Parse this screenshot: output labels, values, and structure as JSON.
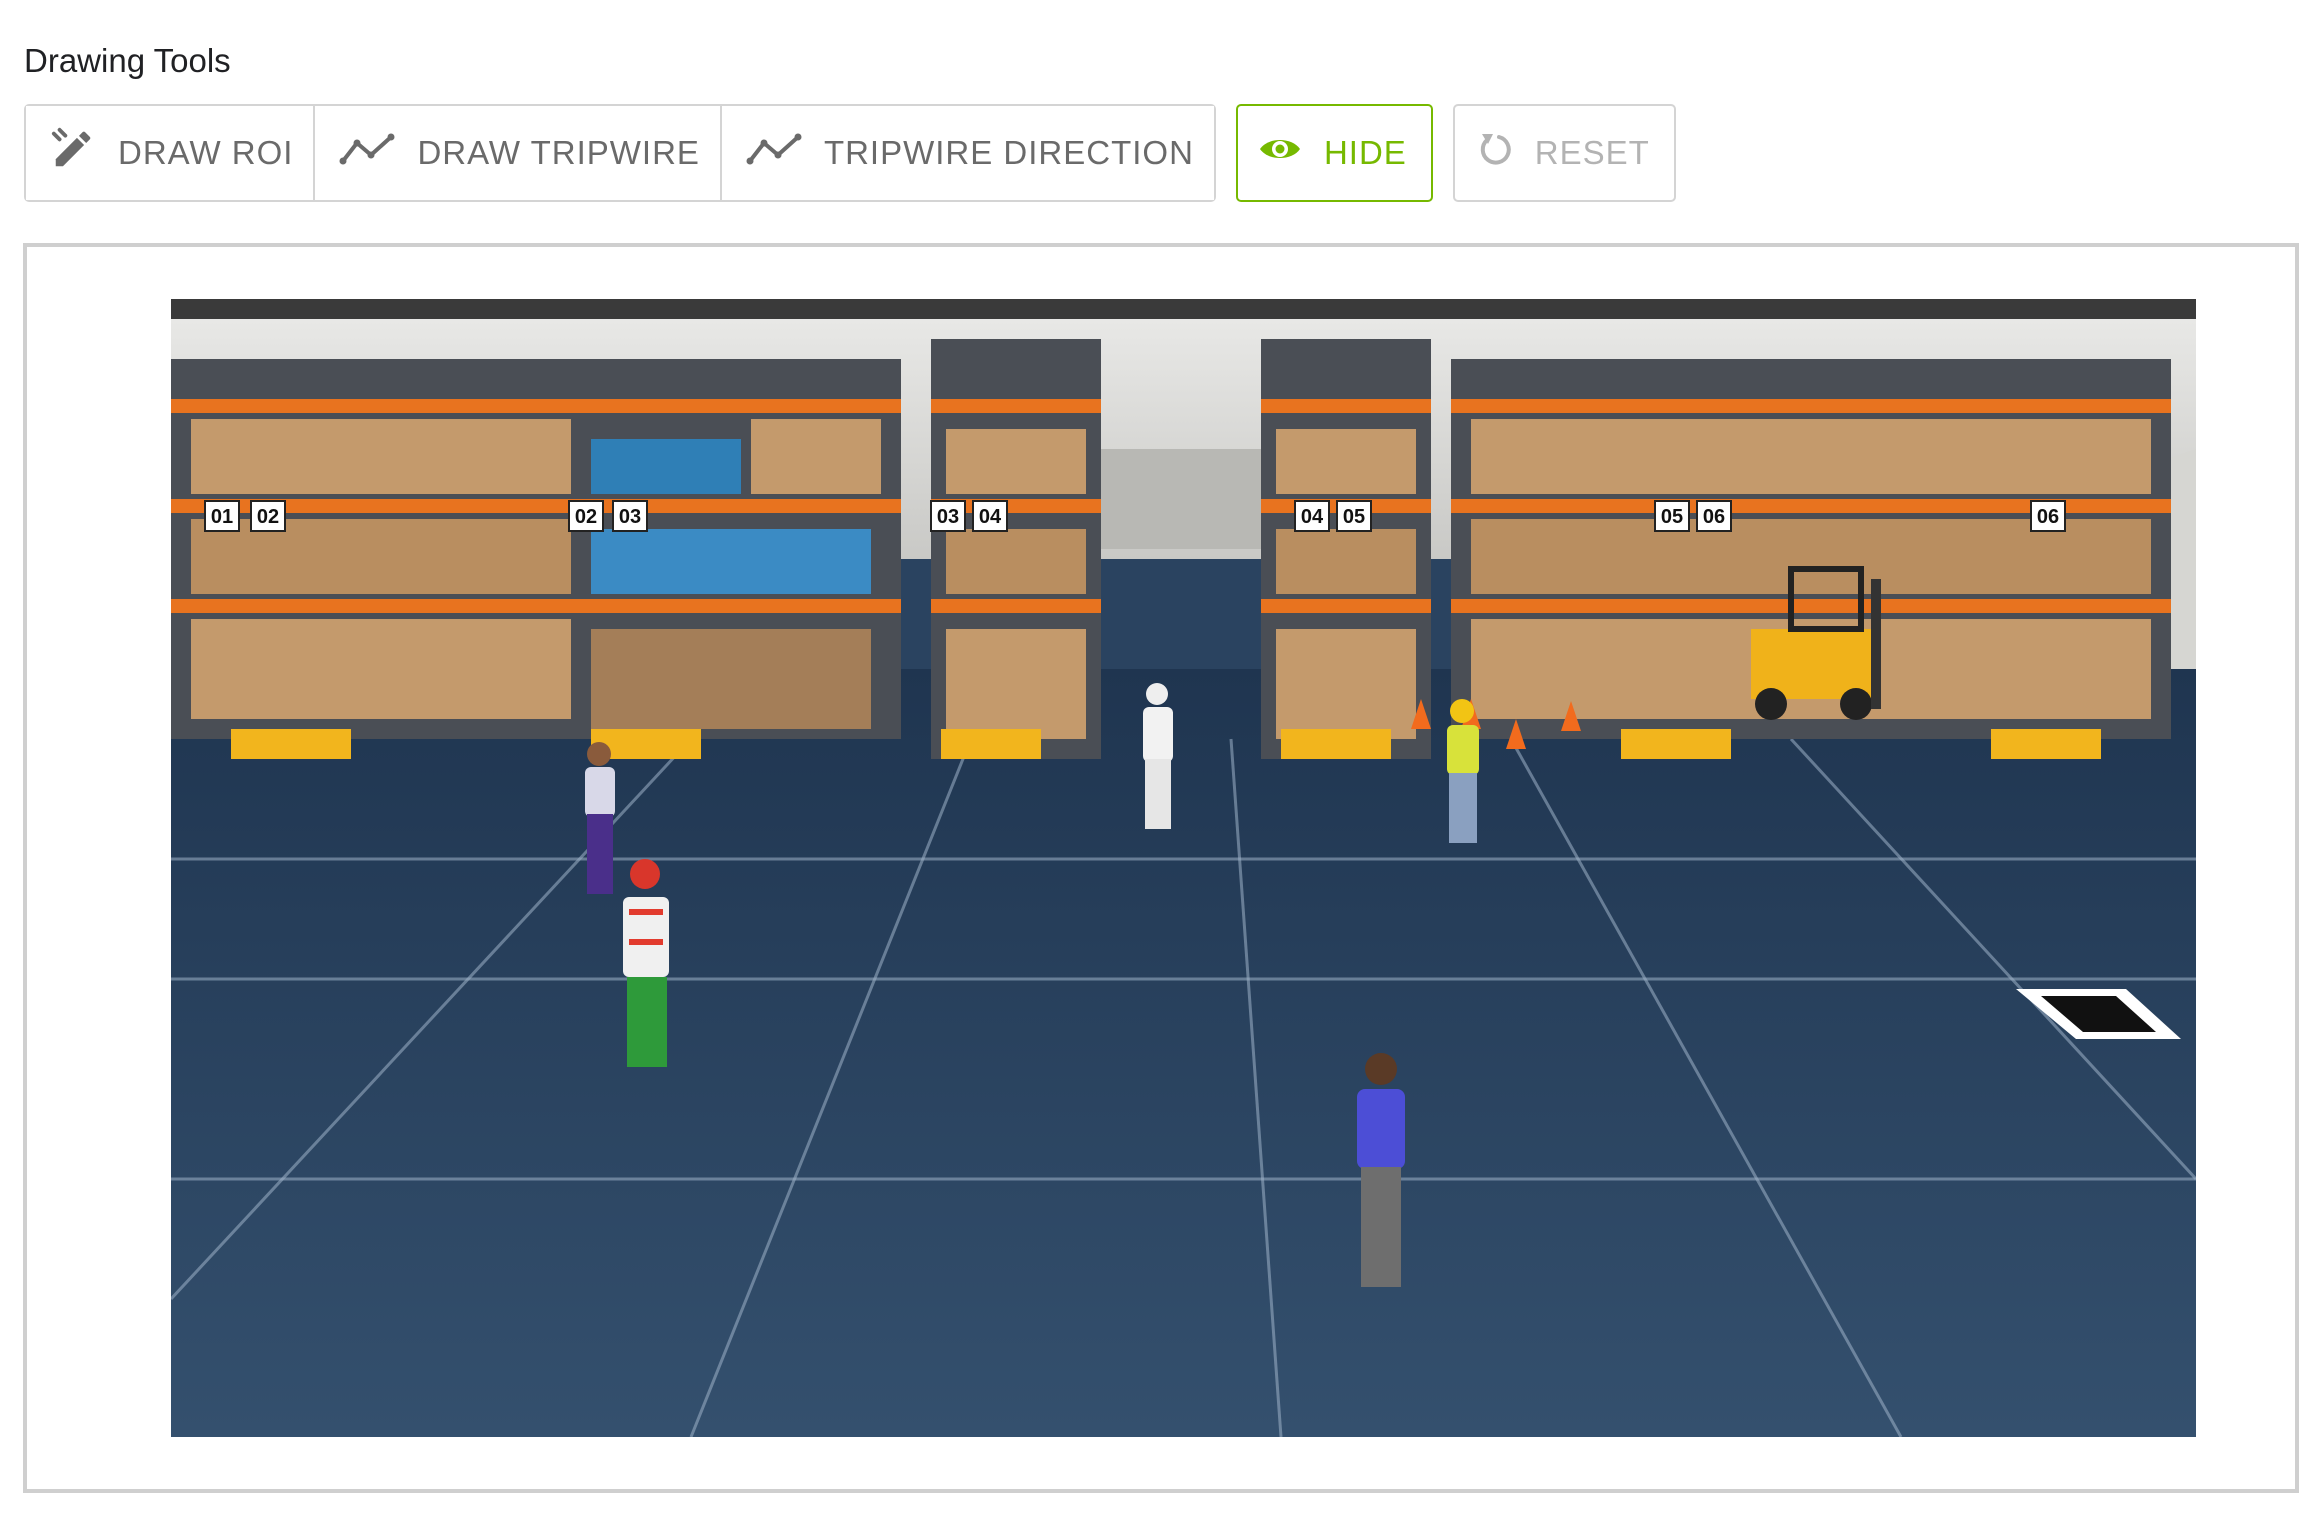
{
  "drawing_tools": {
    "title": "Drawing Tools",
    "buttons": {
      "draw_roi": {
        "label": "DRAW ROI",
        "icon": "edit-pen-icon"
      },
      "draw_tripwire": {
        "label": "DRAW TRIPWIRE",
        "icon": "polyline-icon"
      },
      "tripwire_direction": {
        "label": "TRIPWIRE DIRECTION",
        "icon": "polyline-icon"
      },
      "hide": {
        "label": "HIDE",
        "icon": "eye-icon",
        "state": "active"
      },
      "reset": {
        "label": "RESET",
        "icon": "reset-icon",
        "state": "disabled"
      }
    }
  },
  "video": {
    "rack_labels": [
      "01",
      "02",
      "02",
      "03",
      "03",
      "04",
      "04",
      "05",
      "05",
      "06",
      "06"
    ]
  },
  "colors": {
    "accent": "#76b900",
    "border": "#d4d4d4",
    "text": "#6a6a6a",
    "disabled_text": "#b3b3b3",
    "floor": "#2c4661"
  }
}
